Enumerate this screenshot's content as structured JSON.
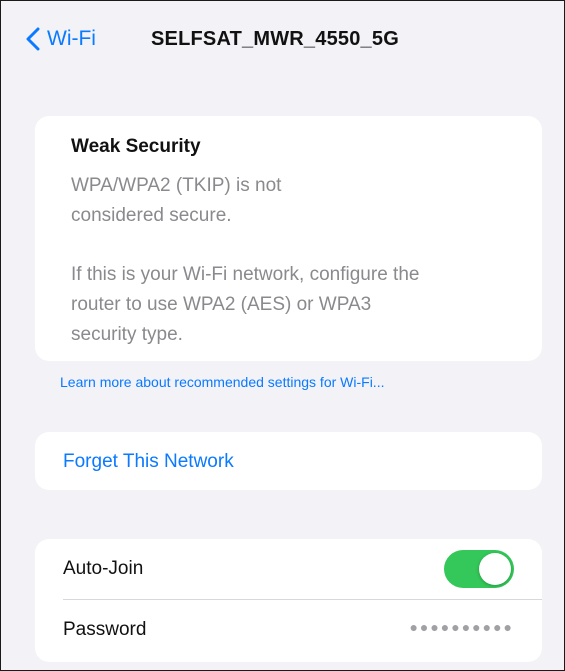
{
  "nav": {
    "back_label": "Wi-Fi",
    "title": "SELFSAT_MWR_4550_5G"
  },
  "security_warning": {
    "title": "Weak Security",
    "line1": "WPA/WPA2 (TKIP) is not",
    "line2": "considered secure.",
    "line3": "If this is your Wi-Fi network, configure the",
    "line4": "router to use WPA2 (AES) or WPA3",
    "line5": "security type."
  },
  "learn_more_link": "Learn more about recommended settings for Wi-Fi...",
  "forget_network_label": "Forget This Network",
  "settings": {
    "auto_join_label": "Auto-Join",
    "auto_join_enabled": true,
    "password_label": "Password",
    "password_masked": "●●●●●●●●●●"
  },
  "colors": {
    "accent": "#0a7aff",
    "toggle_on": "#34c759",
    "background": "#f2f2f7"
  },
  "icons": {
    "back": "chevron-left-icon"
  }
}
